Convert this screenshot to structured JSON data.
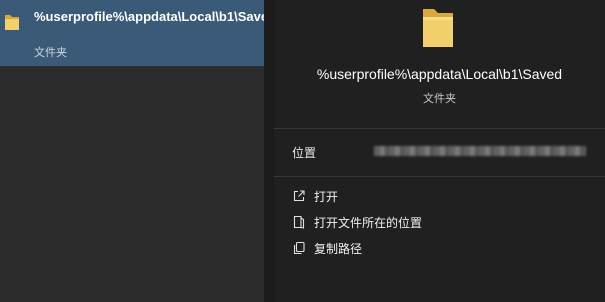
{
  "selected_result": {
    "title": "%userprofile%\\appdata\\Local\\b1\\Saved",
    "type": "文件夹",
    "icon": "folder-icon"
  },
  "details": {
    "title": "%userprofile%\\appdata\\Local\\b1\\Saved",
    "type": "文件夹",
    "location_label": "位置",
    "location_value_redacted": true
  },
  "actions": [
    {
      "label": "打开",
      "icon": "open-external-icon"
    },
    {
      "label": "打开文件所在的位置",
      "icon": "open-folder-location-icon"
    },
    {
      "label": "复制路径",
      "icon": "copy-icon"
    }
  ],
  "colors": {
    "selected_bg": "#3b5a77",
    "folder": "#e8c25a"
  }
}
